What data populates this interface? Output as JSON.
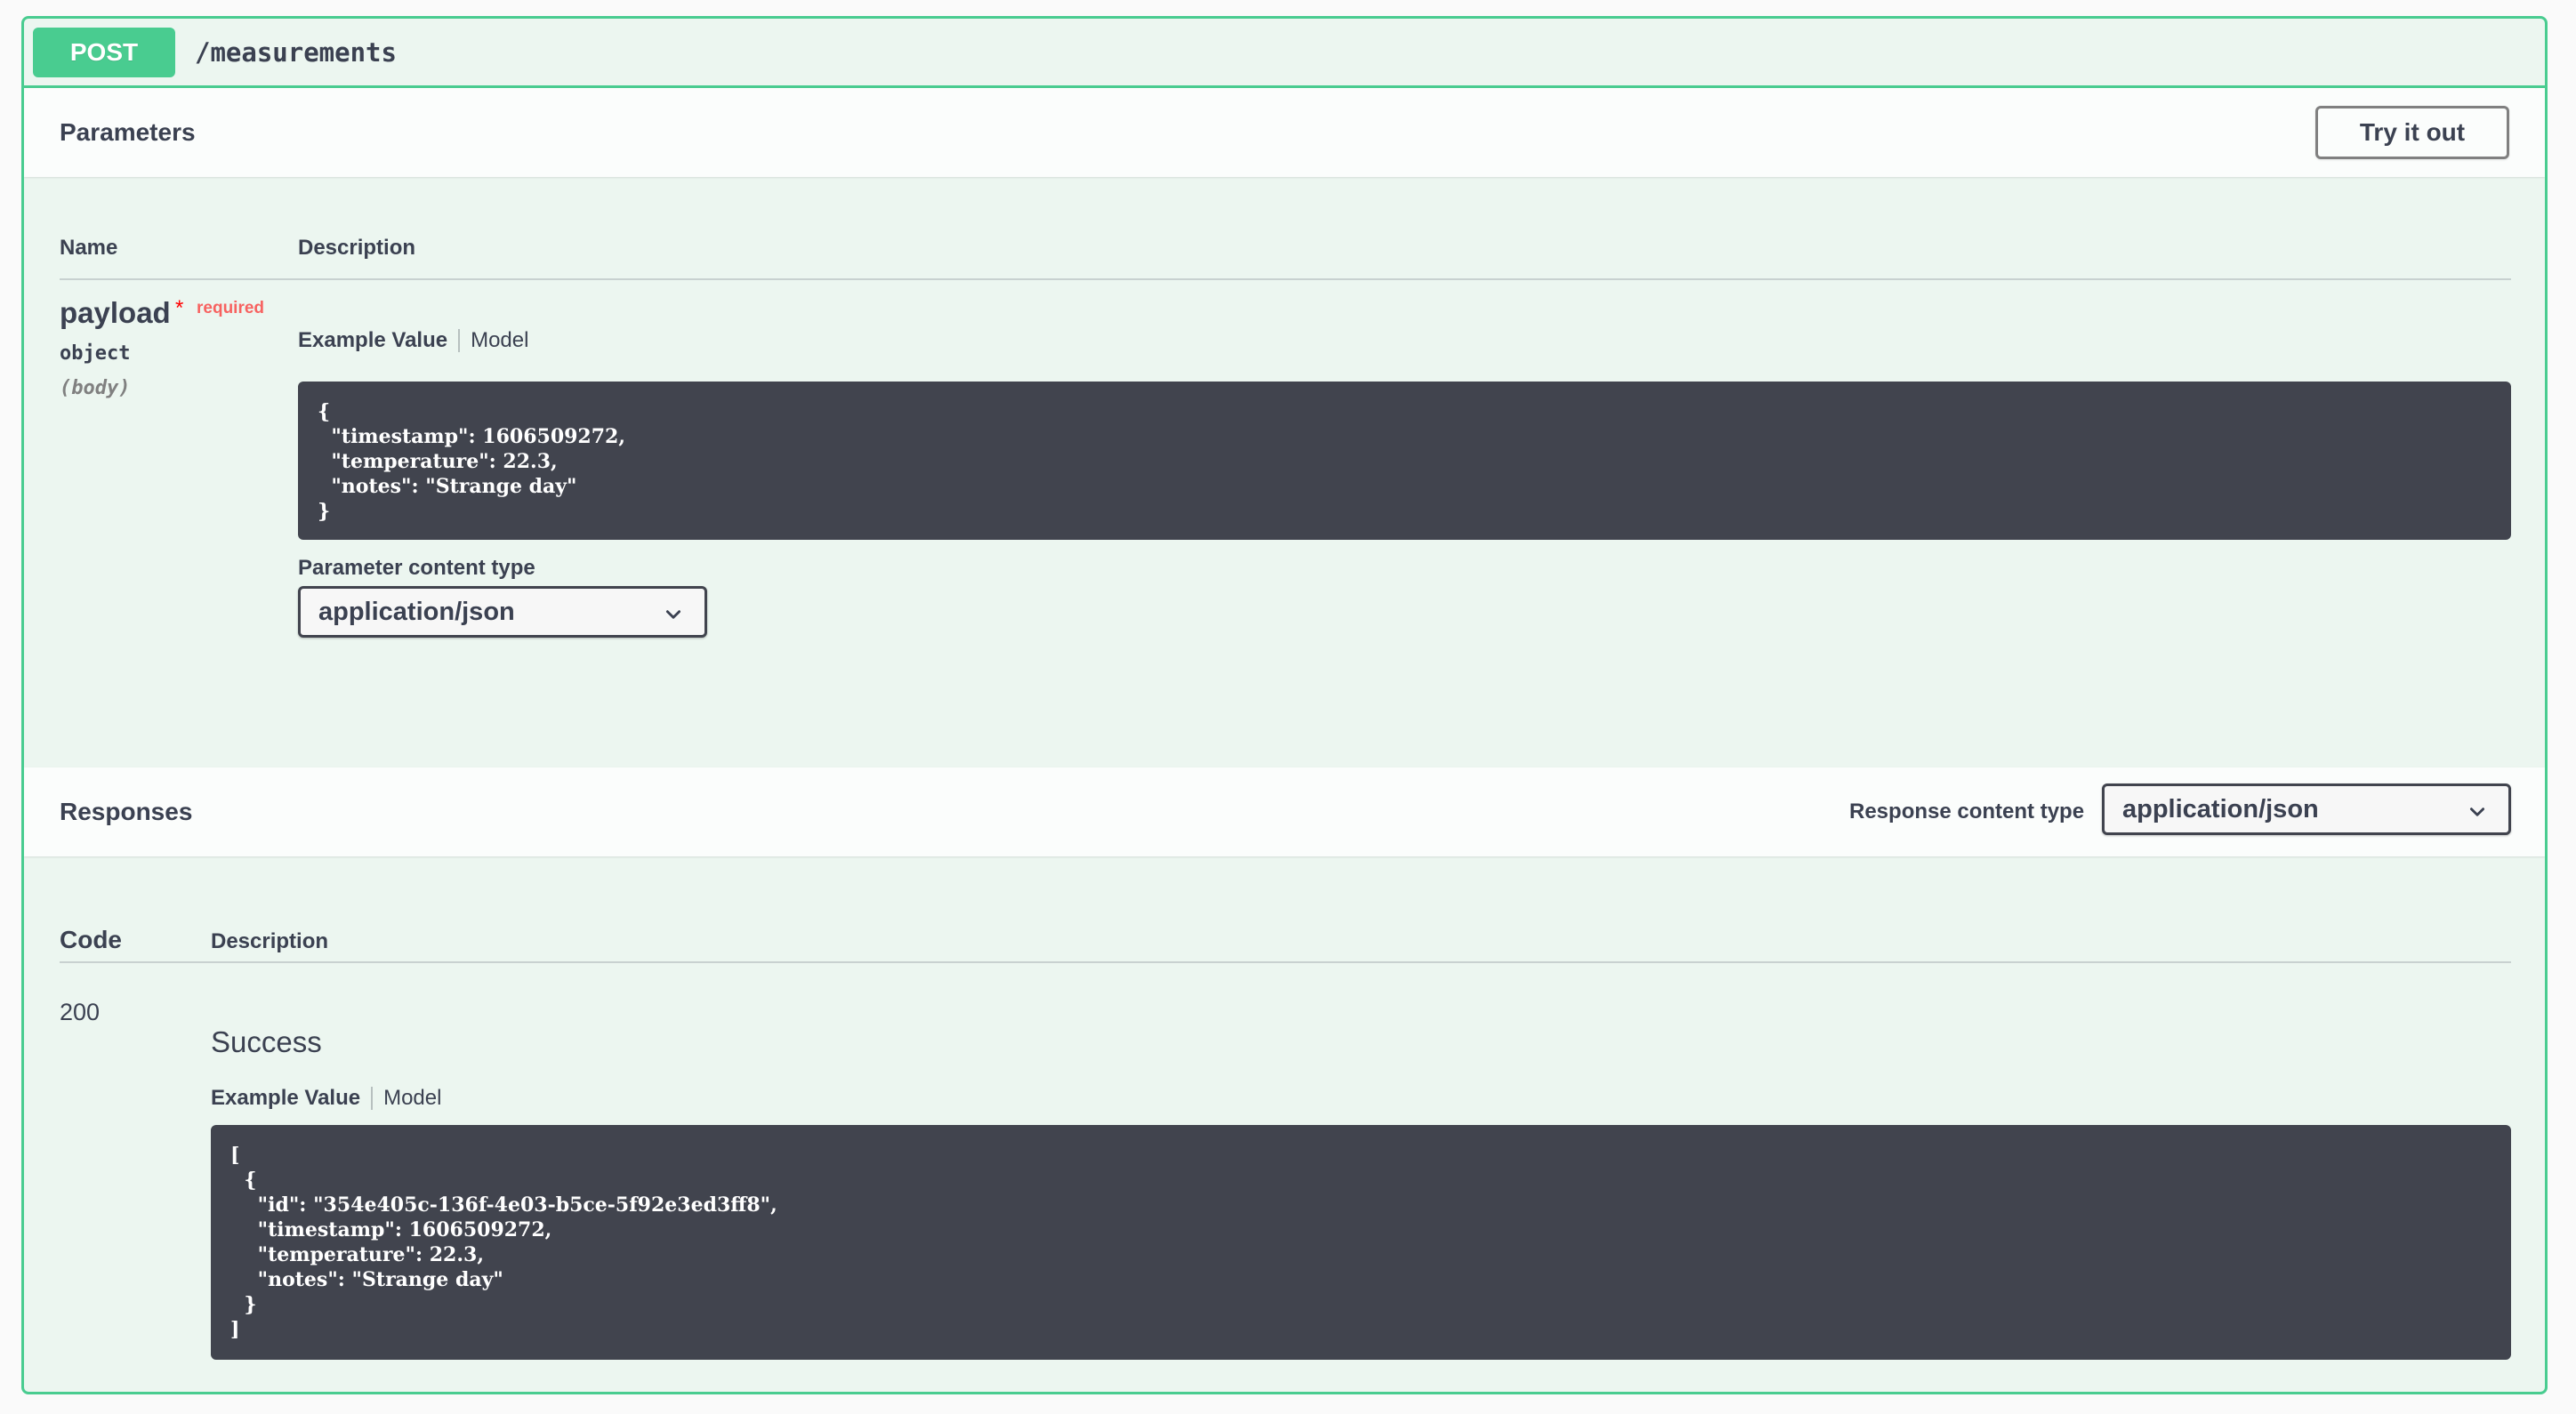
{
  "operation": {
    "method": "POST",
    "path": "/measurements"
  },
  "parameters": {
    "title": "Parameters",
    "try_button": "Try it out",
    "col_name": "Name",
    "col_description": "Description",
    "param": {
      "name": "payload",
      "required_star": "*",
      "required_label": "required",
      "type": "object",
      "in": "(body)"
    },
    "tab_example": "Example Value",
    "tab_model": "Model",
    "example": "{\n  \"timestamp\": 1606509272,\n  \"temperature\": 22.3,\n  \"notes\": \"Strange day\"\n}",
    "content_type_label": "Parameter content type",
    "content_type_value": "application/json"
  },
  "responses": {
    "title": "Responses",
    "content_type_label": "Response content type",
    "content_type_value": "application/json",
    "col_code": "Code",
    "col_description": "Description",
    "rows": [
      {
        "code": "200",
        "description": "Success",
        "tab_example": "Example Value",
        "tab_model": "Model",
        "example": "[\n  {\n    \"id\": \"354e405c-136f-4e03-b5ce-5f92e3ed3ff8\",\n    \"timestamp\": 1606509272,\n    \"temperature\": 22.3,\n    \"notes\": \"Strange day\"\n  }\n]"
      }
    ]
  },
  "colors": {
    "post_accent": "#49cc90",
    "block_bg": "#ecf6f0",
    "code_bg": "#41444e",
    "text": "#3b4151",
    "required": "#ff0000"
  },
  "icons": {
    "select_arrow": "chevron-down-icon"
  }
}
